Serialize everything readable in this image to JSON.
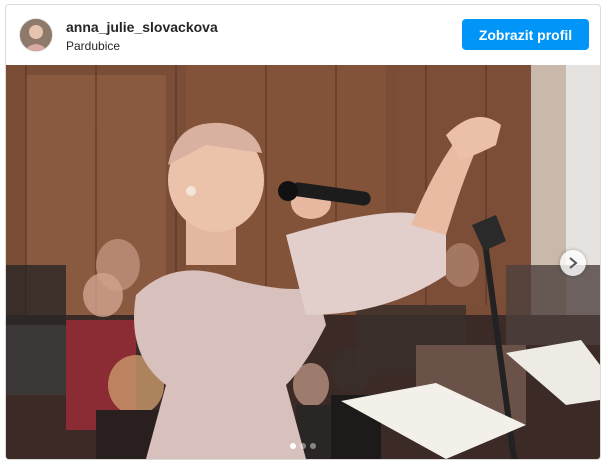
{
  "post": {
    "username": "anna_julie_slovackova",
    "location": "Pardubice",
    "profile_button_label": "Zobrazit profil",
    "brand_color": "#0095f6",
    "photo_description_icon": "photo",
    "carousel": {
      "current": 1,
      "total": 3
    }
  }
}
